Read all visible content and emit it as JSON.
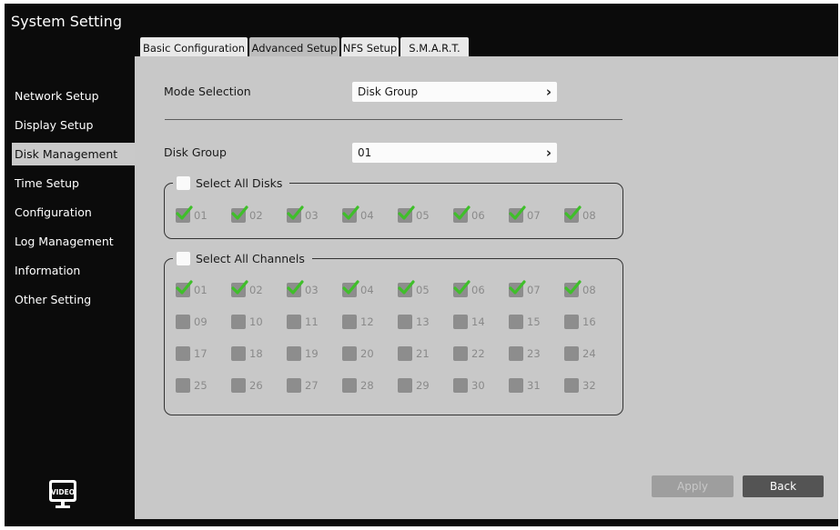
{
  "window_title": "System Setting",
  "tabs": [
    "Basic Configuration",
    "Advanced Setup",
    "NFS Setup",
    "S.M.A.R.T."
  ],
  "sidebar": [
    "Network Setup",
    "Display Setup",
    "Disk Management",
    "Time Setup",
    "Configuration",
    "Log Management",
    "Information",
    "Other Setting"
  ],
  "logo_text": "VIDEO",
  "mode_selection": {
    "label": "Mode Selection",
    "value": "Disk Group"
  },
  "disk_group": {
    "label": "Disk Group",
    "value": "01"
  },
  "select_all_disks": "Select All Disks",
  "disks": [
    {
      "label": "01",
      "checked": true
    },
    {
      "label": "02",
      "checked": true
    },
    {
      "label": "03",
      "checked": true
    },
    {
      "label": "04",
      "checked": true
    },
    {
      "label": "05",
      "checked": true
    },
    {
      "label": "06",
      "checked": true
    },
    {
      "label": "07",
      "checked": true
    },
    {
      "label": "08",
      "checked": true
    }
  ],
  "select_all_channels": "Select All Channels",
  "channels": [
    {
      "label": "01",
      "checked": true
    },
    {
      "label": "02",
      "checked": true
    },
    {
      "label": "03",
      "checked": true
    },
    {
      "label": "04",
      "checked": true
    },
    {
      "label": "05",
      "checked": true
    },
    {
      "label": "06",
      "checked": true
    },
    {
      "label": "07",
      "checked": true
    },
    {
      "label": "08",
      "checked": true
    },
    {
      "label": "09",
      "checked": false
    },
    {
      "label": "10",
      "checked": false
    },
    {
      "label": "11",
      "checked": false
    },
    {
      "label": "12",
      "checked": false
    },
    {
      "label": "13",
      "checked": false
    },
    {
      "label": "14",
      "checked": false
    },
    {
      "label": "15",
      "checked": false
    },
    {
      "label": "16",
      "checked": false
    },
    {
      "label": "17",
      "checked": false
    },
    {
      "label": "18",
      "checked": false
    },
    {
      "label": "19",
      "checked": false
    },
    {
      "label": "20",
      "checked": false
    },
    {
      "label": "21",
      "checked": false
    },
    {
      "label": "22",
      "checked": false
    },
    {
      "label": "23",
      "checked": false
    },
    {
      "label": "24",
      "checked": false
    },
    {
      "label": "25",
      "checked": false
    },
    {
      "label": "26",
      "checked": false
    },
    {
      "label": "27",
      "checked": false
    },
    {
      "label": "28",
      "checked": false
    },
    {
      "label": "29",
      "checked": false
    },
    {
      "label": "30",
      "checked": false
    },
    {
      "label": "31",
      "checked": false
    },
    {
      "label": "32",
      "checked": false
    }
  ],
  "apply_label": "Apply",
  "back_label": "Back",
  "colors": {
    "check_green": "#3fbf2a",
    "panel_bg": "#c8c8c8",
    "window_bg": "#0b0b0b"
  }
}
